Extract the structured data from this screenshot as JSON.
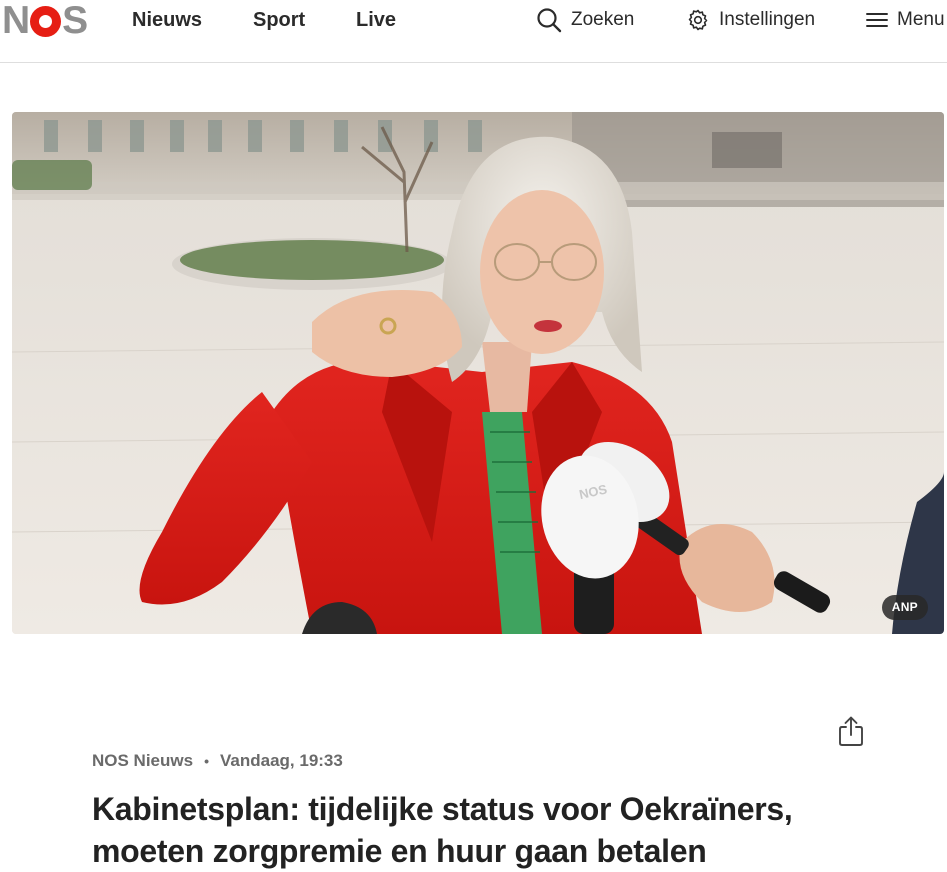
{
  "header": {
    "logo": {
      "letters": [
        "N",
        "O",
        "S"
      ],
      "accent_color": "#e61e14",
      "gray_color": "#8f8f8f"
    },
    "nav": [
      {
        "label": "Nieuws"
      },
      {
        "label": "Sport"
      },
      {
        "label": "Live"
      }
    ],
    "search_label": "Zoeken",
    "settings_label": "Instellingen",
    "menu_label": "Menu"
  },
  "hero": {
    "credit": "ANP",
    "mic_logo": "NOS"
  },
  "article": {
    "source": "NOS Nieuws",
    "separator": "•",
    "timestamp": "Vandaag, 19:33",
    "headline": "Kabinetsplan: tijdelijke status voor Oekraïners, moeten zorgpremie en huur gaan betalen"
  },
  "icons": {
    "search": "search-icon",
    "settings": "gear-icon",
    "menu": "hamburger-icon",
    "share": "share-icon"
  }
}
